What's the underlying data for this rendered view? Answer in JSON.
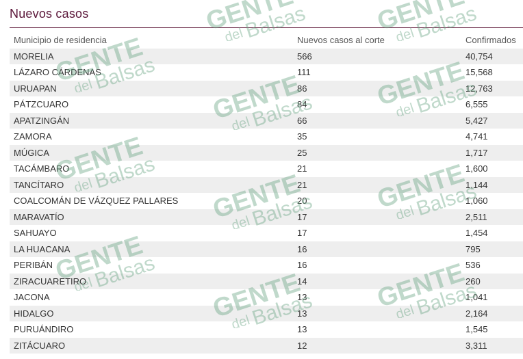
{
  "page": {
    "title": "Nuevos casos"
  },
  "chart_data": {
    "type": "table",
    "columns": [
      "Municipio de residencia",
      "Nuevos casos al corte",
      "Confirmados"
    ],
    "rows": [
      [
        "MORELIA",
        "566",
        "40,754"
      ],
      [
        "LÁZARO CÁRDENAS",
        "111",
        "15,568"
      ],
      [
        "URUAPAN",
        "86",
        "12,763"
      ],
      [
        "PÁTZCUARO",
        "84",
        "6,555"
      ],
      [
        "APATZINGÁN",
        "66",
        "5,427"
      ],
      [
        "ZAMORA",
        "35",
        "4,741"
      ],
      [
        "MÚGICA",
        "25",
        "1,717"
      ],
      [
        "TACÁMBARO",
        "21",
        "1,600"
      ],
      [
        "TANCÍTARO",
        "21",
        "1,144"
      ],
      [
        "COALCOMÁN DE VÁZQUEZ PALLARES",
        "20",
        "1,060"
      ],
      [
        "MARAVATÍO",
        "17",
        "2,511"
      ],
      [
        "SAHUAYO",
        "17",
        "1,454"
      ],
      [
        "LA HUACANA",
        "16",
        "795"
      ],
      [
        "PERIBÁN",
        "16",
        "536"
      ],
      [
        "ZIRACUARETIRO",
        "14",
        "260"
      ],
      [
        "JACONA",
        "13",
        "1,041"
      ],
      [
        "HIDALGO",
        "13",
        "2,164"
      ],
      [
        "PURUÁNDIRO",
        "13",
        "1,545"
      ],
      [
        "ZITÁCUARO",
        "12",
        "3,311"
      ]
    ]
  },
  "watermark": {
    "line1": "GENTE",
    "line2_a": "del",
    "line2_b": "Balsas",
    "color": "#6aa585"
  }
}
